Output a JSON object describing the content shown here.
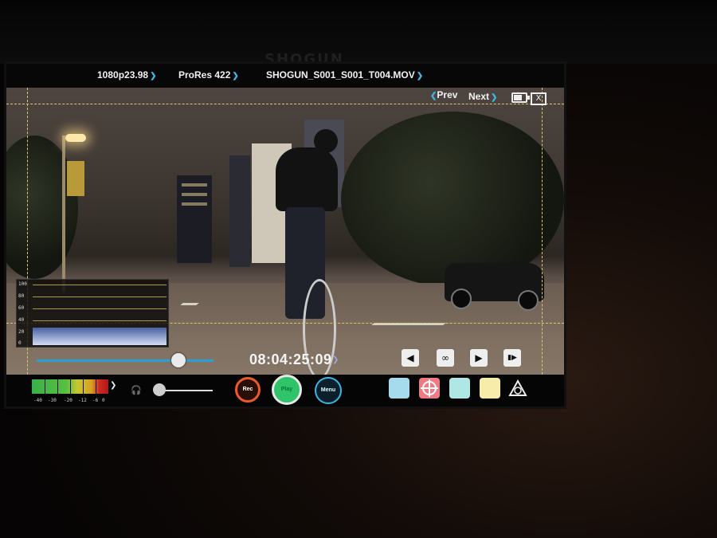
{
  "device": {
    "brand": "SHOGUN"
  },
  "topbar": {
    "format": "1080p23.98",
    "codec": "ProRes 422",
    "filename": "SHOGUN_S001_S001_T004.MOV",
    "prev_label": "Prev",
    "next_label": "Next",
    "chevron": "❯",
    "close_glyph": "X",
    "battery_level": 0.7
  },
  "waveform": {
    "scale_labels": [
      "100",
      "80",
      "60",
      "40",
      "20",
      "0"
    ]
  },
  "playback": {
    "timecode": "08:04:25:09",
    "scrub_position": 0.8,
    "transport_icons": [
      "skip-back-icon",
      "loop-icon",
      "play-icon",
      "step-forward-icon"
    ],
    "transport_glyphs": [
      "◀",
      "∞",
      "▶",
      "▮▶"
    ]
  },
  "audio": {
    "meter_labels": [
      "-40",
      "-30",
      "-20",
      "-12",
      "-6",
      "0"
    ],
    "volume_level": 0.1
  },
  "controls": {
    "rec_label": "Rec",
    "play_label": "Play",
    "menu_label": "Menu",
    "accent_rec": "#ec5a2a",
    "accent_play": "#2fc46a",
    "accent_menu": "#37b8e6"
  },
  "tools": [
    "blue-square",
    "focus-target",
    "mint-square",
    "yellow-square",
    "atomos-logo"
  ]
}
